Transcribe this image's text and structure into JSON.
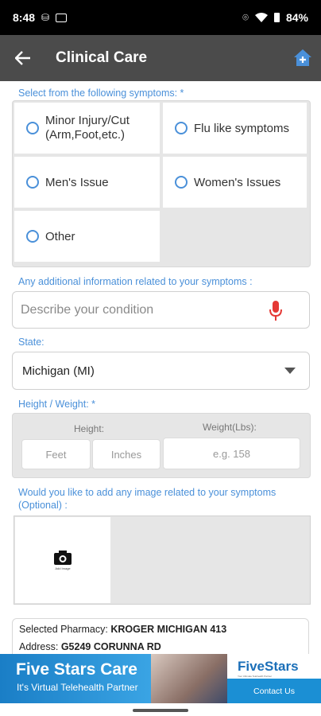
{
  "status": {
    "time": "8:48",
    "battery": "84%"
  },
  "header": {
    "title": "Clinical Care"
  },
  "symptoms": {
    "label": "Select from the following symptoms: *",
    "options": [
      {
        "line1": "Minor Injury/Cut",
        "line2": "(Arm,Foot,etc.)"
      },
      {
        "line1": "Flu like symptoms",
        "line2": ""
      },
      {
        "line1": "Men's Issue",
        "line2": ""
      },
      {
        "line1": "Women's Issues",
        "line2": ""
      },
      {
        "line1": "Other",
        "line2": ""
      }
    ]
  },
  "additional": {
    "label": "Any additional information related to your symptoms :",
    "placeholder": "Describe your condition"
  },
  "state": {
    "label": "State:",
    "value": "Michigan (MI)"
  },
  "height_weight": {
    "label": "Height / Weight: *",
    "height_label": "Height:",
    "weight_label": "Weight(Lbs):",
    "feet_placeholder": "Feet",
    "inches_placeholder": "Inches",
    "weight_placeholder": "e.g. 158"
  },
  "image_upload": {
    "label_line1": "Would you like to add any image related to your symptoms",
    "label_line2": "(Optional) :",
    "slot_caption": "Add Image"
  },
  "pharmacy": {
    "selected_label": "Selected Pharmacy:",
    "selected_value": "KROGER MICHIGAN 413",
    "address_label": "Address:",
    "address_value": "G5249 CORUNNA RD"
  },
  "banner": {
    "title": "Five Stars Care",
    "subtitle": "It's Virtual Telehealth Partner",
    "brand": "FiveStars",
    "brand_tagline": "Your Ultimate Telehealth Partner",
    "cta": "Contact Us"
  },
  "colors": {
    "accent": "#4a90d9",
    "appbar": "#4b4b4b",
    "mic": "#e53935"
  }
}
